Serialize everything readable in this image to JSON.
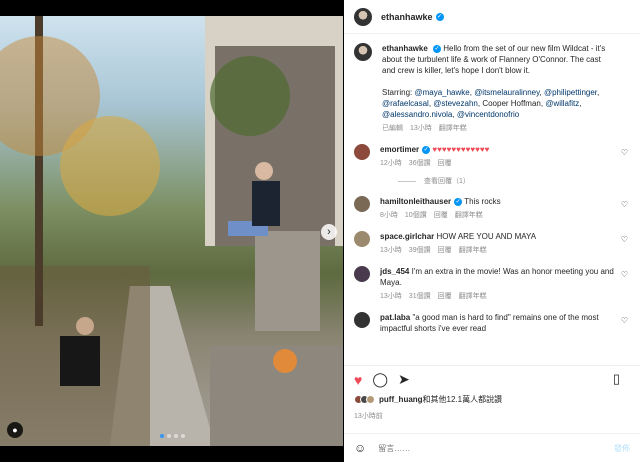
{
  "header": {
    "username": "ethanhawke"
  },
  "caption": {
    "username": "ethanhawke",
    "text": "Hello from the set of our new film Wildcat - it's about the turbulent life & work of Flannery O'Connor. The cast and crew is killer, let's hope I don't blow it.",
    "starring_label": "Starring:",
    "mentions": [
      "@maya_hawke",
      "@itsmelauralinney",
      "@philipettinger",
      "@rafaelcasal",
      "@stevezahn"
    ],
    "plain": "Cooper Hoffman,",
    "mentions2": [
      "@willafitz",
      "@alessandro.nivola",
      "@vincentdonofrio"
    ],
    "edited": "已編輯",
    "time": "13小時",
    "translate": "翻譯年糕"
  },
  "comments": [
    {
      "username": "emortimer",
      "text": "♥♥♥♥♥♥♥♥♥♥♥♥",
      "time": "12小時",
      "likes": "36個讚",
      "reply": "回覆",
      "translate": "",
      "avatar_color": "#8b4a3c",
      "verified": true,
      "red_text": true
    },
    {
      "username": "hamiltonleithauser",
      "text": "This rocks",
      "time": "8小時",
      "likes": "10個讚",
      "reply": "回覆",
      "translate": "翻譯年糕",
      "avatar_color": "#7a6a55",
      "verified": true,
      "red_text": false
    },
    {
      "username": "space.girlchar",
      "text": "HOW ARE YOU AND MAYA",
      "time": "13小時",
      "likes": "39個讚",
      "reply": "回覆",
      "translate": "翻譯年糕",
      "avatar_color": "#9b8a6e",
      "verified": false,
      "red_text": false
    },
    {
      "username": "jds_454",
      "text": "I'm an extra in the movie! Was an honor meeting you and Maya.",
      "time": "13小時",
      "likes": "31個讚",
      "reply": "回覆",
      "translate": "翻譯年糕",
      "avatar_color": "#4a3a4e",
      "verified": false,
      "red_text": false
    },
    {
      "username": "pat.laba",
      "text": "\"a good man is hard to find\" remains one of the most impactful shorts i've ever read",
      "time": "",
      "likes": "",
      "reply": "",
      "translate": "",
      "avatar_color": "#333333",
      "verified": false,
      "red_text": false
    }
  ],
  "view_replies": "查看回覆（1）",
  "likes_text": {
    "user": "puff_huang",
    "rest": "和其他12.1萬人都說讚"
  },
  "post_date": "13小時前",
  "add_comment": {
    "placeholder": "留言……",
    "post_label": "發佈"
  },
  "colors": {
    "accent": "#0095f6",
    "like_red": "#ed4956"
  },
  "icons": [
    "heart-icon",
    "comment-icon",
    "share-icon",
    "bookmark-icon",
    "emoji-icon",
    "next-arrow-icon",
    "user-tag-icon",
    "verified-icon"
  ]
}
